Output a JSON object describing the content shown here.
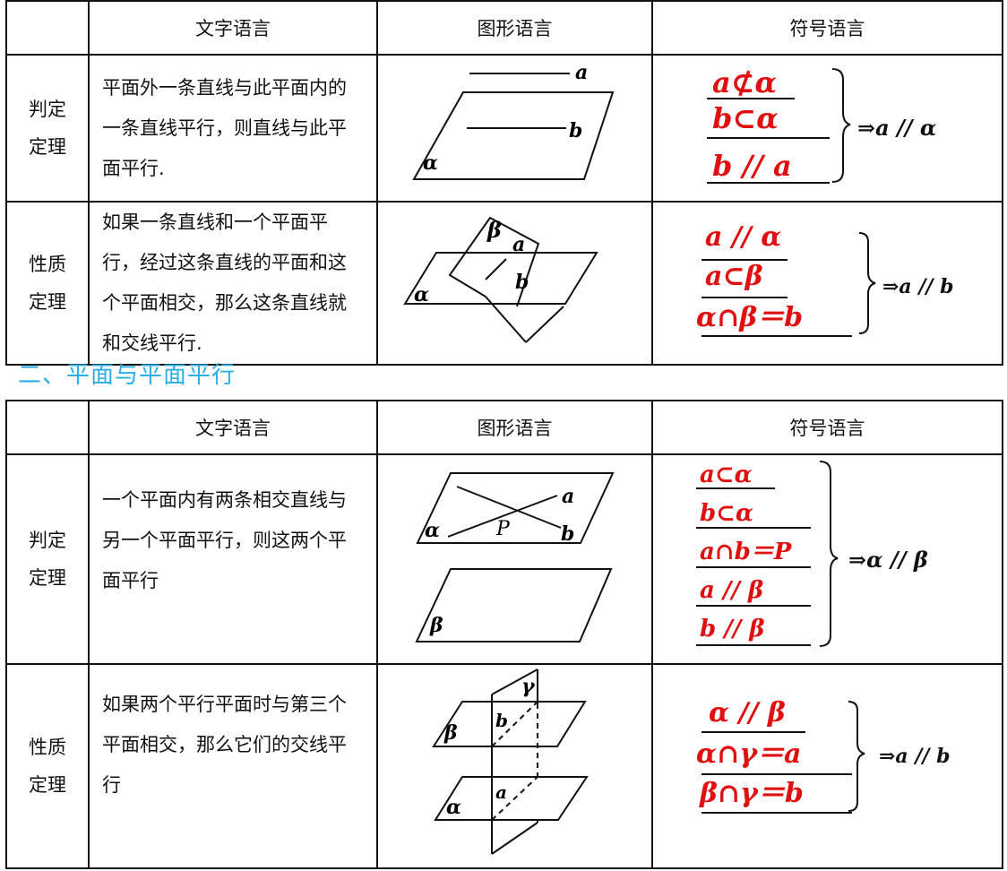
{
  "headers": {
    "blank": "",
    "text": "文字语言",
    "figure": "图形语言",
    "symbol": "符号语言"
  },
  "section1": {
    "rows": [
      {
        "label_l1": "判定",
        "label_l2": "定理",
        "text": "平面外一条直线与此平面内的一条直线平行，则直线与此平面平行.",
        "fig_labels": {
          "line_top": "a",
          "line_in": "b",
          "plane": "α"
        },
        "symbols": [
          "a⊄α",
          "b⊂α",
          "b // a"
        ],
        "conclusion": "⇒a // α"
      },
      {
        "label_l1": "性质",
        "label_l2": "定理",
        "text": "如果一条直线和一个平面平行，经过这条直线的平面和这个平面相交，那么这条直线就和交线平行.",
        "fig_labels": {
          "beta": "β",
          "line_a": "a",
          "line_b": "b",
          "alpha": "α"
        },
        "symbols": [
          "a // α",
          "a⊂β",
          "α∩β＝b"
        ],
        "conclusion": "⇒a // b"
      }
    ]
  },
  "section2_title": "二、平面与平面平行",
  "section2": {
    "rows": [
      {
        "label_l1": "判定",
        "label_l2": "定理",
        "text": "一个平面内有两条相交直线与另一个平面平行，则这两个平面平行",
        "fig_labels": {
          "a": "a",
          "b": "b",
          "p": "P",
          "alpha": "α",
          "beta": "β"
        },
        "symbols": [
          "a⊂α",
          "b⊂α",
          "a∩b＝P",
          "a // β",
          "b // β"
        ],
        "conclusion": "⇒α // β"
      },
      {
        "label_l1": "性质",
        "label_l2": "定理",
        "text": "如果两个平行平面时与第三个平面相交，那么它们的交线平行",
        "fig_labels": {
          "gamma": "γ",
          "beta": "β",
          "b": "b",
          "alpha": "α",
          "a": "a"
        },
        "symbols": [
          "α // β",
          "α∩γ＝a",
          "β∩γ＝b"
        ],
        "conclusion": "⇒a // b"
      }
    ]
  },
  "colors": {
    "symbol_red": "#e01010",
    "section_blue": "#29aee6"
  }
}
